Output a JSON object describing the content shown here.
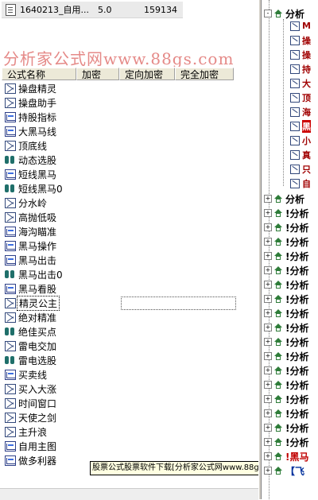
{
  "top_row": {
    "name": "1640213_自用...",
    "version": "5.0",
    "number": "159134"
  },
  "watermark": "分析家公式网www.88gs.com",
  "columns": [
    "公式名称",
    "加密",
    "定向加密",
    "完全加密"
  ],
  "formulas": [
    {
      "name": "操盘精灵",
      "icon": "formula-icon"
    },
    {
      "name": "操盘助手",
      "icon": "formula-icon"
    },
    {
      "name": "持股指标",
      "icon": "chart-indicator-icon"
    },
    {
      "name": "大黑马线",
      "icon": "chart-indicator-icon"
    },
    {
      "name": "顶底线",
      "icon": "formula-icon"
    },
    {
      "name": "动态选股",
      "icon": "binoculars-icon"
    },
    {
      "name": "短线黑马",
      "icon": "chart-indicator-icon"
    },
    {
      "name": "短线黑马0",
      "icon": "binoculars-icon"
    },
    {
      "name": "分水岭",
      "icon": "formula-icon"
    },
    {
      "name": "高抛低吸",
      "icon": "formula-icon"
    },
    {
      "name": "海沟瞄准",
      "icon": "chart-indicator-icon"
    },
    {
      "name": "黑马操作",
      "icon": "chart-indicator-icon"
    },
    {
      "name": "黑马出击",
      "icon": "chart-indicator-icon"
    },
    {
      "name": "黑马出击0",
      "icon": "binoculars-icon"
    },
    {
      "name": "黑马看股",
      "icon": "chart-indicator-icon"
    },
    {
      "name": "精灵公主",
      "icon": "formula-icon",
      "selected": true
    },
    {
      "name": "绝对精准",
      "icon": "formula-icon"
    },
    {
      "name": "绝佳买点",
      "icon": "binoculars-icon"
    },
    {
      "name": "雷电交加",
      "icon": "formula-icon"
    },
    {
      "name": "雷电选股",
      "icon": "binoculars-icon"
    },
    {
      "name": "买卖线",
      "icon": "chart-indicator-icon"
    },
    {
      "name": "买入大涨",
      "icon": "formula-icon"
    },
    {
      "name": "时间窗口",
      "icon": "formula-icon"
    },
    {
      "name": "天使之剑",
      "icon": "formula-icon"
    },
    {
      "name": "主升浪",
      "icon": "formula-icon"
    },
    {
      "name": "自用主图",
      "icon": "chart-indicator-icon"
    },
    {
      "name": "做多利器",
      "icon": "chart-indicator-icon"
    }
  ],
  "tooltip": "股票公式股票软件下载[分析家公式网www.88gs.com]",
  "tree": {
    "top_node": "分析",
    "sub_items": [
      "M",
      "操",
      "操",
      "持",
      "大",
      "顶",
      "海",
      "黑",
      "小",
      "真",
      "只",
      "自"
    ],
    "collapsed_nodes": [
      "分析",
      "!分析",
      "!分析",
      "!分析",
      "!分析",
      "!分析",
      "!分析",
      "!分析",
      "!分析",
      "!分析",
      "!分析",
      "!分析",
      "!分析",
      "!分析",
      "!分析",
      "!分析",
      "!分析",
      "!分析",
      "!黑马",
      "【飞"
    ]
  }
}
